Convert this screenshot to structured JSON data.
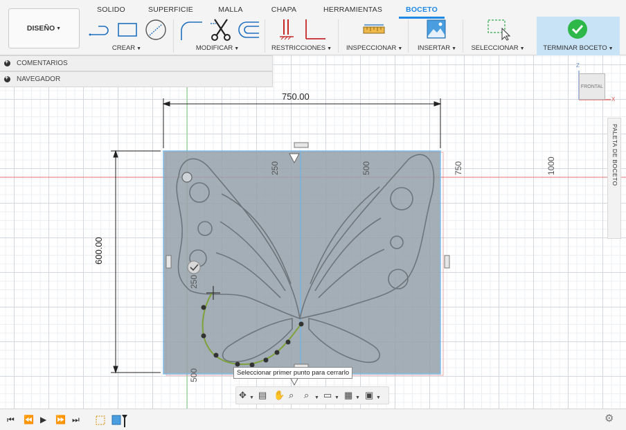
{
  "tabs": [
    "SOLIDO",
    "SUPERFICIE",
    "MALLA",
    "CHAPA",
    "HERRAMIENTAS",
    "BOCETO"
  ],
  "active_tab": "BOCETO",
  "workspace_button": "DISEÑO",
  "tool_groups": {
    "create": "CREAR",
    "modify": "MODIFICAR",
    "constraints": "RESTRICCIONES",
    "inspect": "INSPECCIONAR",
    "insert": "INSERTAR",
    "select": "SELECCIONAR",
    "finish": "TERMINAR BOCETO"
  },
  "panels": {
    "comments": "COMENTARIOS",
    "navigator": "NAVEGADOR"
  },
  "dimensions": {
    "width": "750.00",
    "height": "600.00"
  },
  "ruler_labels": {
    "x_250": "250",
    "x_500": "500",
    "x_750": "750",
    "x_1000": "1000",
    "y_250": "250",
    "y_500": "500"
  },
  "tooltip": "Seleccionar primer punto para cerrarlo",
  "viewcube": {
    "face": "FRONTAL",
    "axis_z": "Z",
    "axis_x": "X"
  },
  "sketch_palette": "PALETA DE BOCETO",
  "colors": {
    "accent": "#1e88e5",
    "finish_bg": "#c8e2f6",
    "finish_check": "#2fb84a",
    "red_axis": "#e05050",
    "green_axis": "#5fbf5f",
    "sketch_curve": "#7ea23a",
    "canvas_image_fill": "#98a3ad"
  }
}
